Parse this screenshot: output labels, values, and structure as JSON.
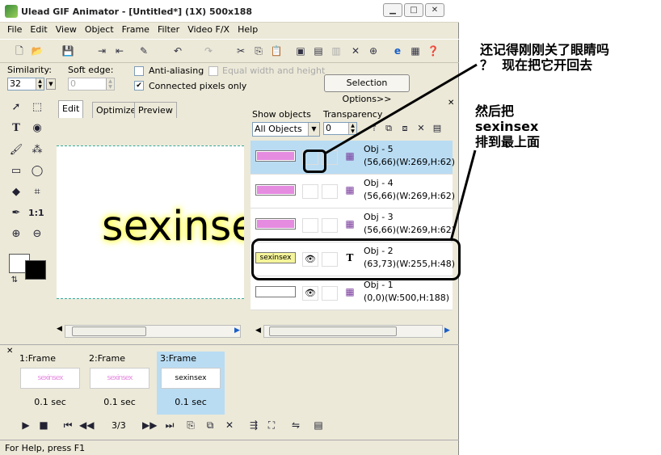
{
  "window": {
    "title": "Ulead GIF Animator - [Untitled*] (1X) 500x188"
  },
  "menu": [
    "File",
    "Edit",
    "View",
    "Object",
    "Frame",
    "Filter",
    "Video F/X",
    "Help"
  ],
  "options": {
    "similarity_label": "Similarity:",
    "similarity_value": "32",
    "soft_edge_label": "Soft edge:",
    "soft_edge_value": "0",
    "anti_aliasing": "Anti-aliasing",
    "equal": "Equal width and height",
    "connected": "Connected pixels only",
    "selection_options": "Selection Options>>"
  },
  "edit_tabs": [
    "Edit",
    "Optimize",
    "Preview"
  ],
  "canvas_text": "sexinsex",
  "objects_panel": {
    "show_label": "Show objects",
    "show_value": "All Objects",
    "transparency_label": "Transparency",
    "transparency_value": "0",
    "objects": [
      {
        "name": "Obj - 5",
        "info": "(56,66)(W:269,H:62)"
      },
      {
        "name": "Obj - 4",
        "info": "(56,66)(W:269,H:62)"
      },
      {
        "name": "Obj - 3",
        "info": "(56,66)(W:269,H:62)"
      },
      {
        "name": "Obj - 2",
        "info": "(63,73)(W:255,H:48)",
        "thumb_text": "sexinsex"
      },
      {
        "name": "Obj - 1",
        "info": "(0,0)(W:500,H:188)"
      }
    ]
  },
  "frames": [
    {
      "label": "1:Frame",
      "delay": "0.1 sec",
      "thumb": "sexinsex"
    },
    {
      "label": "2:Frame",
      "delay": "0.1 sec",
      "thumb": "sexinsex"
    },
    {
      "label": "3:Frame",
      "delay": "0.1 sec",
      "thumb": "sexinsex"
    }
  ],
  "frame_counter": "3/3",
  "status": "For Help, press F1",
  "annotations": {
    "note1": "还记得刚刚关了眼睛吗\n？  现在把它开回去",
    "note2": "然后把\nsexinsex\n排到最上面"
  }
}
